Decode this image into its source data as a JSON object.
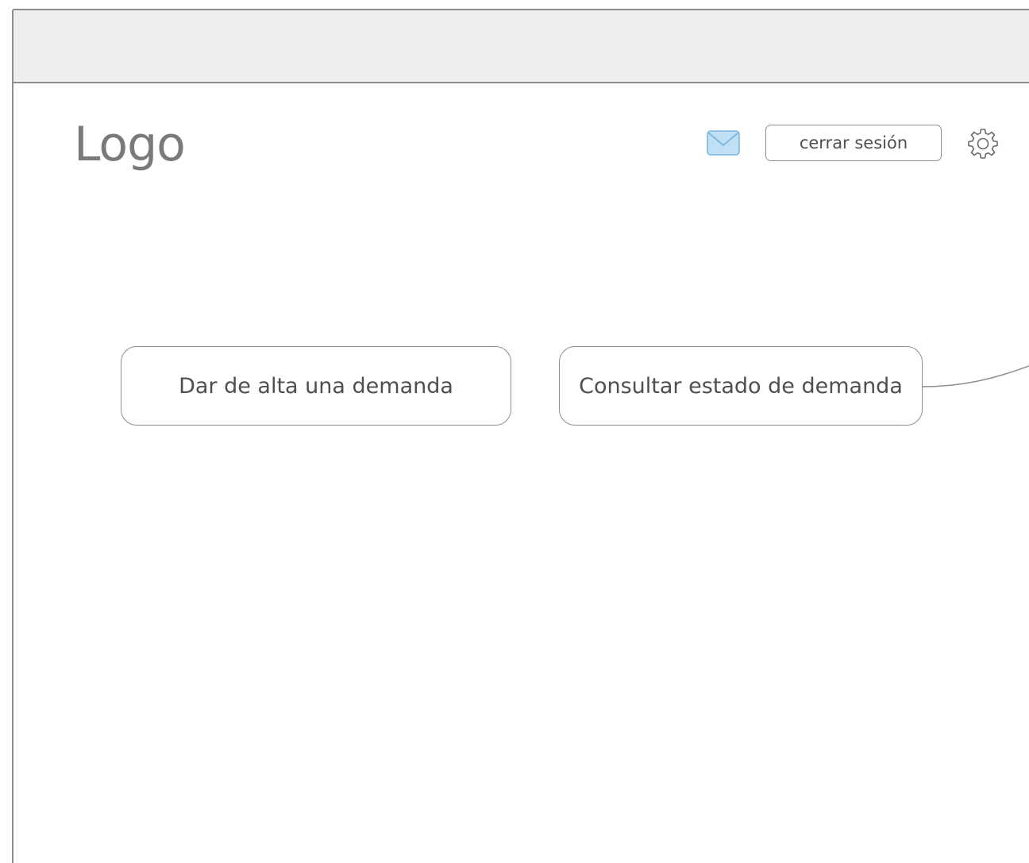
{
  "header": {
    "logo_text": "Logo",
    "logout_label": "cerrar sesión",
    "mail_icon": "envelope-icon",
    "settings_icon": "gear-icon",
    "accent_color": "#bfe0f5"
  },
  "main": {
    "actions": [
      {
        "label": "Dar de alta una demanda"
      },
      {
        "label": "Consultar estado de demanda"
      }
    ]
  }
}
